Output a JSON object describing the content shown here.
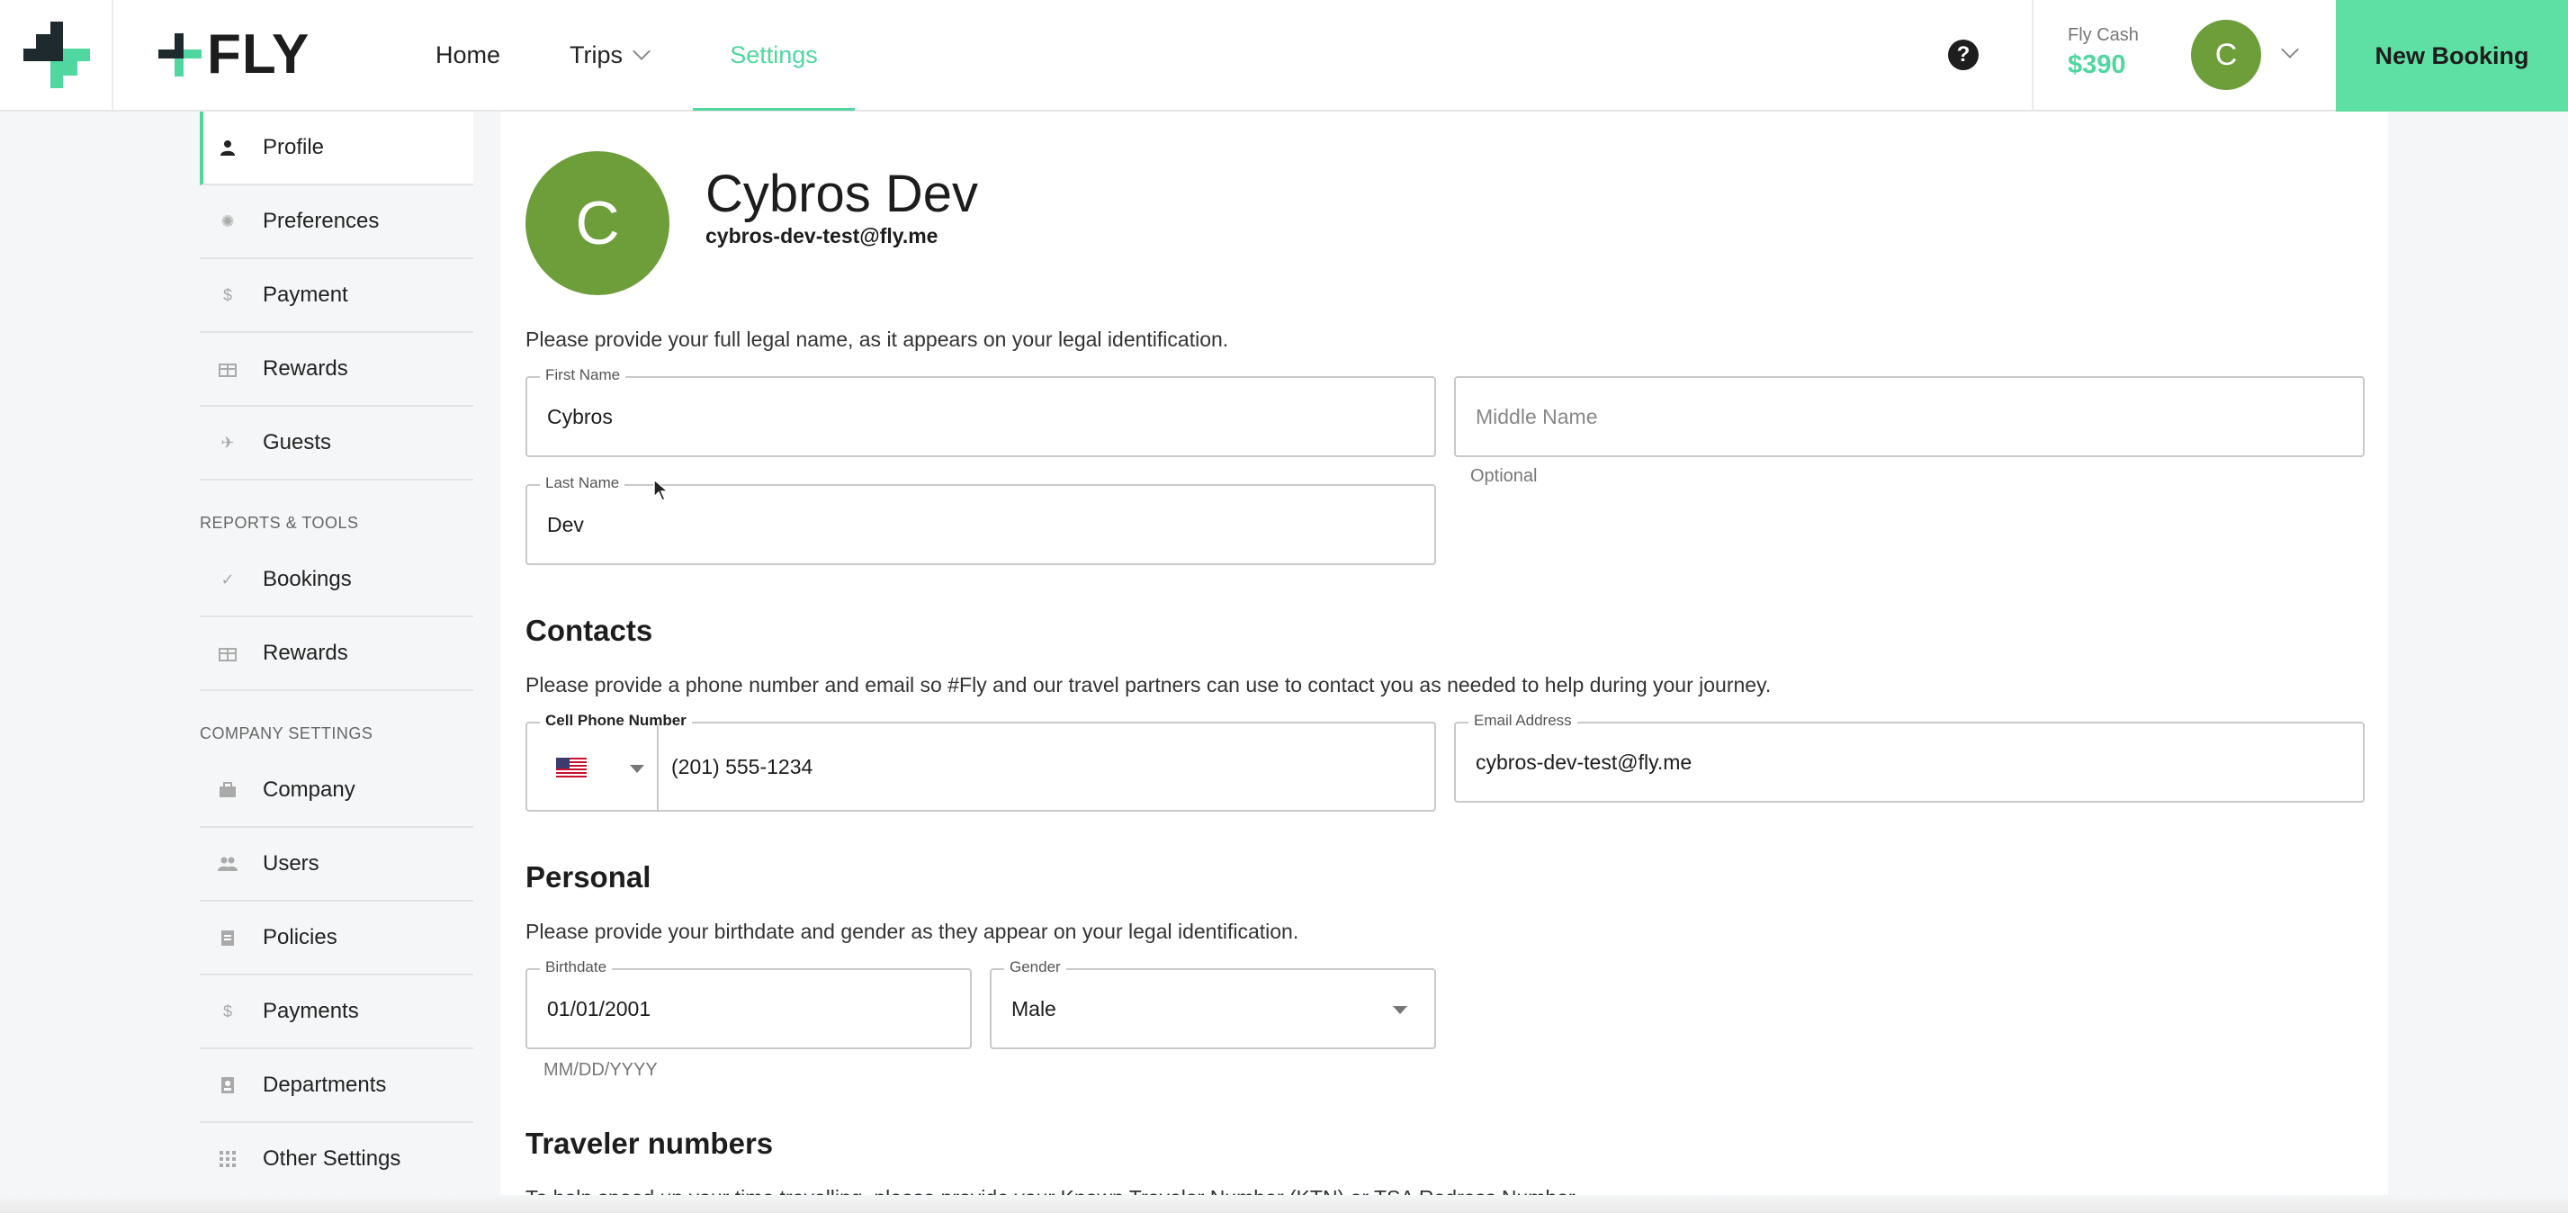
{
  "header": {
    "brand": "FLY",
    "nav": {
      "home": "Home",
      "trips": "Trips",
      "settings": "Settings"
    },
    "help_glyph": "?",
    "fly_cash_label": "Fly Cash",
    "fly_cash_value": "$390",
    "avatar_initial": "C",
    "new_booking": "New Booking"
  },
  "sidebar": {
    "items": [
      {
        "label": "Profile",
        "icon": "person-icon",
        "active": true
      },
      {
        "label": "Preferences",
        "icon": "gear-icon"
      },
      {
        "label": "Payment",
        "icon": "dollar-icon"
      },
      {
        "label": "Rewards",
        "icon": "gift-icon"
      },
      {
        "label": "Guests",
        "icon": "plane-icon"
      }
    ],
    "reports_heading": "REPORTS & TOOLS",
    "reports": [
      {
        "label": "Bookings",
        "icon": "check-icon"
      },
      {
        "label": "Rewards",
        "icon": "gift-icon"
      }
    ],
    "company_heading": "COMPANY SETTINGS",
    "company": [
      {
        "label": "Company",
        "icon": "briefcase-icon"
      },
      {
        "label": "Users",
        "icon": "users-icon"
      },
      {
        "label": "Policies",
        "icon": "clipboard-icon"
      },
      {
        "label": "Payments",
        "icon": "dollar-icon"
      },
      {
        "label": "Departments",
        "icon": "badge-icon"
      },
      {
        "label": "Other Settings",
        "icon": "grid-icon"
      }
    ]
  },
  "profile": {
    "initial": "C",
    "name": "Cybros Dev",
    "email": "cybros-dev-test@fly.me",
    "name_instructions": "Please provide your full legal name, as it appears on your legal identification.",
    "first_name_label": "First Name",
    "first_name_value": "Cybros",
    "middle_name_placeholder": "Middle Name",
    "middle_name_helper": "Optional",
    "last_name_label": "Last Name",
    "last_name_value": "Dev"
  },
  "contacts": {
    "title": "Contacts",
    "instructions": "Please provide a phone number and email so #Fly and our travel partners can use to contact you as needed to help during your journey.",
    "phone_label": "Cell Phone Number",
    "phone_value": "(201) 555-1234",
    "email_label": "Email Address",
    "email_value": "cybros-dev-test@fly.me"
  },
  "personal": {
    "title": "Personal",
    "instructions": "Please provide your birthdate and gender as they appear on your legal identification.",
    "birthdate_label": "Birthdate",
    "birthdate_value": "01/01/2001",
    "birthdate_helper": "MM/DD/YYYY",
    "gender_label": "Gender",
    "gender_value": "Male"
  },
  "traveler_numbers": {
    "title": "Traveler numbers",
    "instructions": "To help speed up your time travelling, please provide your Known Traveler Number (KTN) or TSA Redress Number."
  },
  "colors": {
    "accent": "#4fd79f",
    "new_booking_bg": "#5ee0a4",
    "avatar_bg": "#6d9e3a"
  }
}
